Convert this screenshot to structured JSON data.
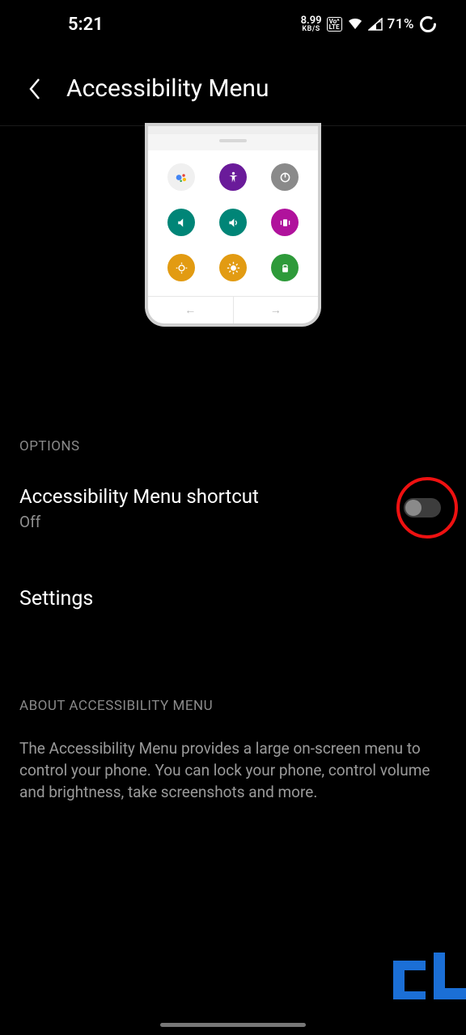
{
  "status": {
    "time": "5:21",
    "kbps_value": "8.99",
    "kbps_label": "KB/S",
    "lte_top": "Vo^",
    "lte_bot": "LTE",
    "battery": "71%"
  },
  "header": {
    "title": "Accessibility Menu"
  },
  "options": {
    "header": "OPTIONS",
    "shortcut": {
      "title": "Accessibility Menu shortcut",
      "state": "Off"
    },
    "settings_label": "Settings"
  },
  "about": {
    "header": "ABOUT ACCESSIBILITY MENU",
    "body": "The Accessibility Menu provides a large on-screen menu to control your phone. You can lock your phone, control volume and brightness, take screenshots and more."
  }
}
